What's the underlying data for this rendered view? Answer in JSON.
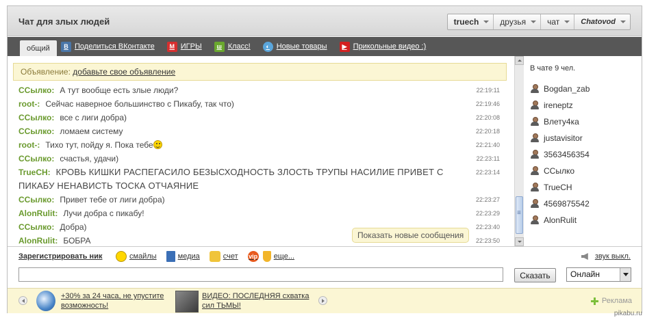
{
  "header": {
    "title": "Чат для злых людей",
    "menu": [
      {
        "label": "truech",
        "bold": true
      },
      {
        "label": "друзья"
      },
      {
        "label": "чат"
      },
      {
        "label": "Chatovod",
        "brand": true
      }
    ]
  },
  "tabs": {
    "active": "общий",
    "links": [
      {
        "label": "Поделиться ВКонтакте",
        "icon": "vk-icon",
        "glyph": "B",
        "color": "#4a76a8"
      },
      {
        "label": "ИГРЫ",
        "icon": "games-icon",
        "glyph": "M",
        "color": "#d62f2f"
      },
      {
        "label": "Класс!",
        "icon": "class-icon",
        "glyph": "ш",
        "color": "#6aa82e"
      },
      {
        "label": "Новые товары",
        "icon": "goods-icon",
        "glyph": "◐",
        "color": "#5aa6dc"
      },
      {
        "label": "Прикольные видео :)",
        "icon": "video-icon",
        "glyph": "▶",
        "color": "#d32020"
      }
    ]
  },
  "announcement": {
    "prefix": "Объявление:",
    "link": "добавьте свое объявление"
  },
  "messages": [
    {
      "nick": "ССылко:",
      "text": "А тут вообще есть злые люди?",
      "time": "22:19:11"
    },
    {
      "nick": "root-:",
      "text": "Сейчас наверное большинство с Пикабу, так что)",
      "time": "22:19:46"
    },
    {
      "nick": "ССылко:",
      "text": "все с лиги добра)",
      "time": "22:20:08"
    },
    {
      "nick": "ССылко:",
      "text": "ломаем систему",
      "time": "22:20:18"
    },
    {
      "nick": "root-:",
      "text": "Тихо тут, пойду я. Пока тебе",
      "time": "22:21:40",
      "smiley": true
    },
    {
      "nick": "ССылко:",
      "text": "счастья, удачи)",
      "time": "22:23:11"
    },
    {
      "nick": "TrueCH:",
      "text": "КРОВЬ КИШКИ РАСПЕГАСИЛО БЕЗЫСХОДНОСТЬ ЗЛОСТЬ ТРУПЫ НАСИЛИЕ ПРИВЕТ С ПИКАБУ НЕНАВИСТЬ ТОСКА ОТЧАЯНИЕ",
      "time": "22:23:14",
      "big": true
    },
    {
      "nick": "ССылко:",
      "text": "Привет тебе от лиги добра)",
      "time": "22:23:27"
    },
    {
      "nick": "AlonRulit:",
      "text": "Лучи добра с пикабу!",
      "time": "22:23:29"
    },
    {
      "nick": "ССылко:",
      "text": "Добра)",
      "time": "22:23:40"
    },
    {
      "nick": "AlonRulit:",
      "text": "БОБРА",
      "time": "22:23:50"
    }
  ],
  "new_messages_label": "Показать новые сообщения",
  "sidebar": {
    "online": "В чате 9 чел.",
    "users": [
      "Bogdan_zab",
      "ireneptz",
      "Влету4ка",
      "justavisitor",
      "3563456354",
      "ССылко",
      "TrueCH",
      "4569875542",
      "AlonRulit"
    ]
  },
  "toolbar": {
    "register": "Зарегистрировать ник",
    "tools": [
      {
        "label": "смайлы",
        "icon": "smiley-icon"
      },
      {
        "label": "медиа",
        "icon": "media-icon"
      },
      {
        "label": "счет",
        "icon": "coins-icon"
      },
      {
        "label": "еще...",
        "icon": "vip-icon"
      }
    ],
    "vip": "vip",
    "sound": "звук выкл."
  },
  "input": {
    "value": "",
    "say": "Сказать",
    "status": "Онлайн"
  },
  "ads": [
    {
      "text": "+30% за 24 часа, не упустите возможность!"
    },
    {
      "text": "ВИДЕО: ПОСЛЕДНЯЯ схватка сил ТЬМЫ!"
    }
  ],
  "ad_label": "Реклама",
  "watermark": "pikabu.ru",
  "colors": {
    "nick": "#6a9a2e",
    "tabbar": "#575757",
    "announce_bg": "#fbf6d4"
  }
}
